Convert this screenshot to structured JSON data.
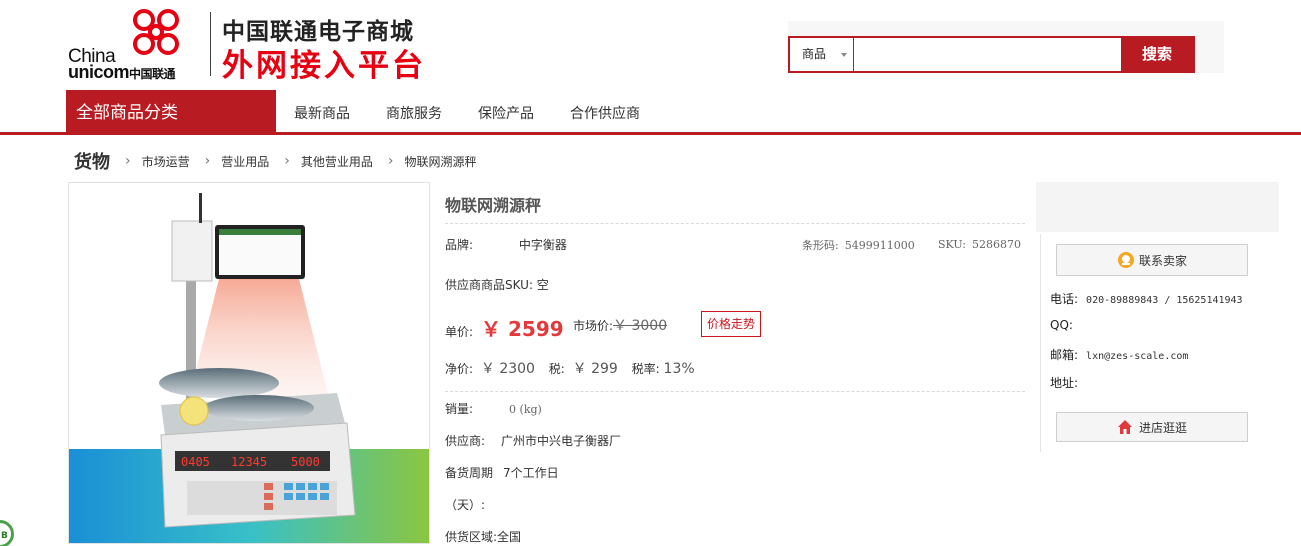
{
  "brand": {
    "logo_en_line1": "China",
    "logo_en_line2": "unicom",
    "logo_cn": "中国联通",
    "slogan_line1": "中国联通电子商城",
    "slogan_line2": "外网接入平台",
    "accent_color": "#b81c22"
  },
  "search": {
    "category": "商品",
    "value": "",
    "button_label": "搜索"
  },
  "nav": {
    "all_categories": "全部商品分类",
    "items": [
      "最新商品",
      "商旅服务",
      "保险产品",
      "合作供应商"
    ]
  },
  "breadcrumb": {
    "root": "货物",
    "items": [
      "市场运营",
      "营业用品",
      "其他营业用品",
      "物联网溯源秤"
    ]
  },
  "scale_display": {
    "weight": "0405",
    "unit_price": "12345",
    "total": "5000"
  },
  "product": {
    "title": "物联网溯源秤",
    "brand_label": "品牌:",
    "brand_value": "中字衡器",
    "barcode_label": "条形码:",
    "barcode_value": "5499911000",
    "sku_label": "SKU:",
    "sku_value": "5286870",
    "supplier_sku": "供应商商品SKU: 空",
    "unit_price_label": "单价:",
    "unit_price": "￥ 2599",
    "market_price_label": "市场价:",
    "market_price": "￥ 3000",
    "trend_button": "价格走势",
    "net_label": "净价:",
    "net_value": "￥ 2300",
    "tax_label": "税:",
    "tax_value": "￥ 299",
    "tax_rate_label": "税率:",
    "tax_rate_value": "13%",
    "sales_label": "销量:",
    "sales_value": "0 (kg)",
    "supplier_label": "供应商:",
    "supplier_value": "广州市中兴电子衡器厂",
    "lead_time_label": "备货周期",
    "lead_time_value": "7个工作日",
    "lead_time_unit": "（天）:",
    "area_label": "供货区域:",
    "area_value": "全国"
  },
  "seller": {
    "contact_button": "联系卖家",
    "phone_label": "电话:",
    "phone_value": "020-89889843 / 15625141943",
    "qq_label": "QQ:",
    "qq_value": "",
    "email_label": "邮箱:",
    "email_value": "lxn@zes-scale.com",
    "address_label": "地址:",
    "address_value": "",
    "shop_button": "进店逛逛"
  }
}
